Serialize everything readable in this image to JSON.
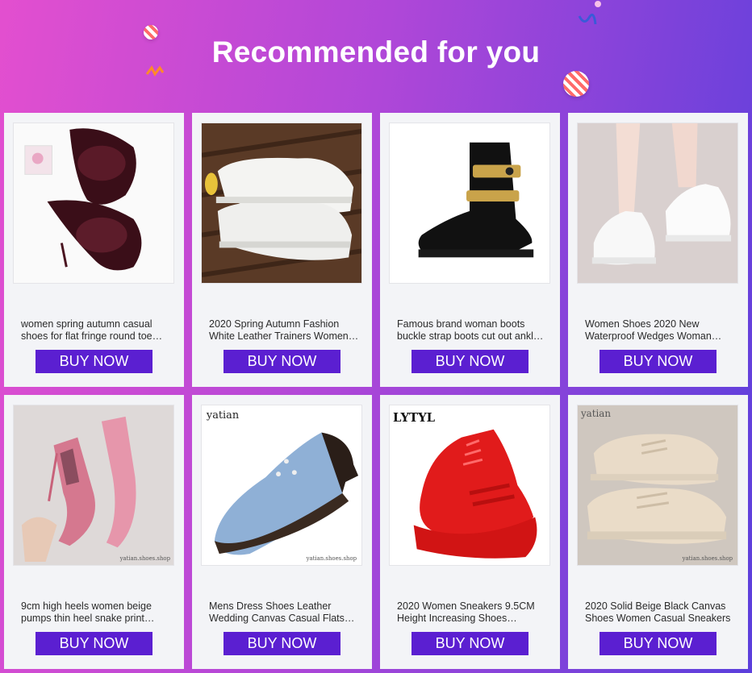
{
  "page": {
    "title": "Recommended for you"
  },
  "products": [
    {
      "title": "women spring autumn casual shoes for flat fringe round toe lace-up oxfords patent leather",
      "buy_label": "BUY NOW",
      "image": "burgundy-oxford-shoes"
    },
    {
      "title": "2020 Spring Autumn Fashion White Leather Trainers Women Casual Shoes",
      "buy_label": "BUY NOW",
      "image": "white-leather-trainers"
    },
    {
      "title": "Famous brand woman boots buckle strap boots cut out ankle boots",
      "buy_label": "BUY NOW",
      "image": "black-buckle-boot"
    },
    {
      "title": "Women Shoes 2020 New Waterproof Wedges Woman White Sneakers",
      "buy_label": "BUY NOW",
      "image": "white-wedge-sneakers"
    },
    {
      "title": "9cm high heels women beige pumps thin heel snake print pointed toe",
      "buy_label": "BUY NOW",
      "image": "pink-snake-heels",
      "watermark": "yatian.shoes.shop"
    },
    {
      "title": "Mens Dress Shoes Leather Wedding Canvas Casual Flats Lace-up",
      "buy_label": "BUY NOW",
      "image": "blue-canvas-shoe",
      "brand": "yatian",
      "watermark": "yatian.shoes.shop"
    },
    {
      "title": "2020 Women Sneakers 9.5CM Height Increasing Shoes Platform",
      "buy_label": "BUY NOW",
      "image": "red-platform-sneaker",
      "brand": "LYTYL"
    },
    {
      "title": "2020 Solid Beige Black Canvas Shoes Women Casual Sneakers",
      "buy_label": "BUY NOW",
      "image": "beige-canvas-sneakers",
      "brand": "yatian",
      "watermark": "yatian.shoes.shop"
    }
  ],
  "colors": {
    "button": "#5b1fd1",
    "card": "#f3f4f7"
  }
}
